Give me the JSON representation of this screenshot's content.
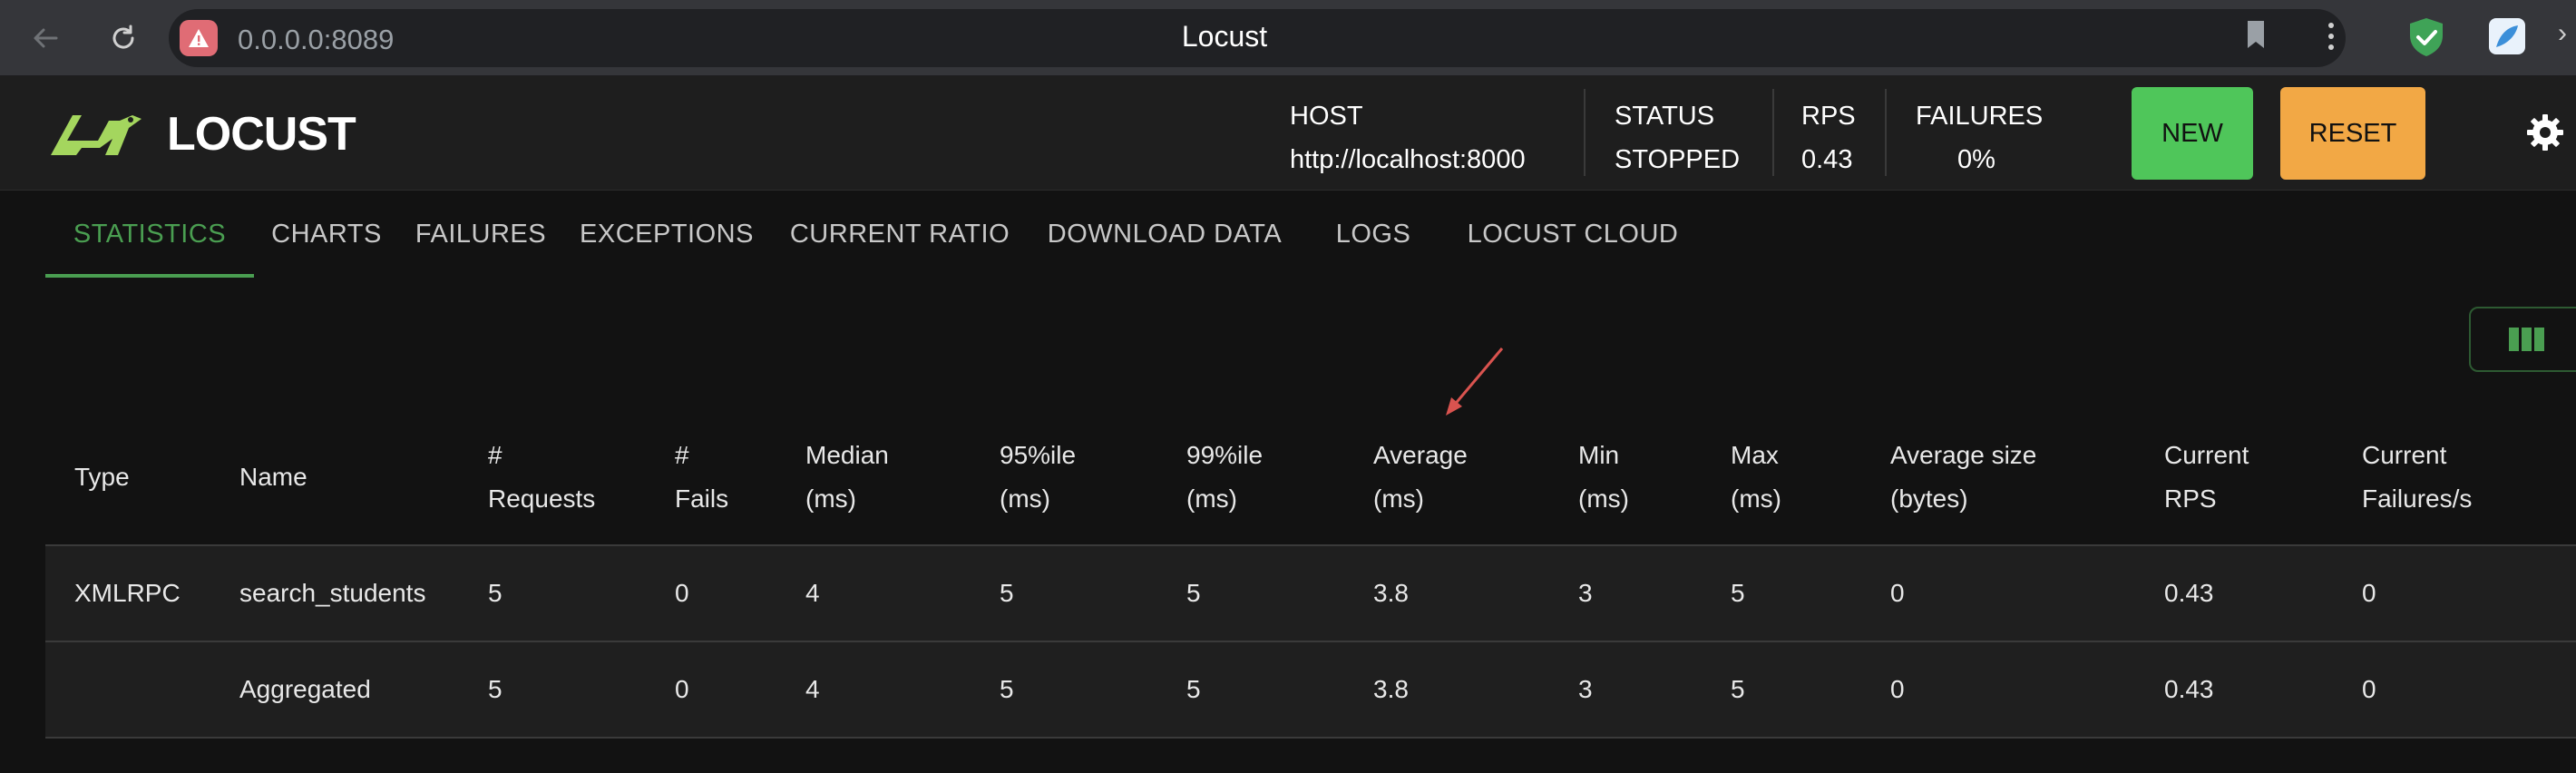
{
  "browser": {
    "url": "0.0.0.0:8089",
    "tab_title": "Locust"
  },
  "app": {
    "logo_text": "LOCUST",
    "stats": [
      {
        "label": "HOST",
        "value": "http://localhost:8000"
      },
      {
        "label": "STATUS",
        "value": "STOPPED"
      },
      {
        "label": "RPS",
        "value": "0.43"
      },
      {
        "label": "FAILURES",
        "value": "0%"
      }
    ],
    "buttons": {
      "new": "NEW",
      "reset": "RESET"
    }
  },
  "tabs": [
    {
      "label": "STATISTICS",
      "active": true
    },
    {
      "label": "CHARTS",
      "active": false
    },
    {
      "label": "FAILURES",
      "active": false
    },
    {
      "label": "EXCEPTIONS",
      "active": false
    },
    {
      "label": "CURRENT RATIO",
      "active": false
    },
    {
      "label": "DOWNLOAD DATA",
      "active": false
    },
    {
      "label": "LOGS",
      "active": false
    },
    {
      "label": "LOCUST CLOUD",
      "active": false
    }
  ],
  "table": {
    "headers": [
      "Type",
      "Name",
      "#\nRequests",
      "#\nFails",
      "Median\n(ms)",
      "95%ile\n(ms)",
      "99%ile\n(ms)",
      "Average\n(ms)",
      "Min\n(ms)",
      "Max\n(ms)",
      "Average size\n(bytes)",
      "Current\nRPS",
      "Current\nFailures/s"
    ],
    "rows": [
      [
        "XMLRPC",
        "search_students",
        "5",
        "0",
        "4",
        "5",
        "5",
        "3.8",
        "3",
        "5",
        "0",
        "0.43",
        "0"
      ],
      [
        "",
        "Aggregated",
        "5",
        "0",
        "4",
        "5",
        "5",
        "3.8",
        "3",
        "5",
        "0",
        "0.43",
        "0"
      ]
    ]
  },
  "icons": {
    "back": "back-arrow-icon",
    "reload": "reload-icon",
    "warning": "warning-icon",
    "bookmark": "bookmark-icon",
    "menu": "menu-dots-icon",
    "shield": "shield-check-icon",
    "settings": "gear-icon",
    "columns": "columns-icon"
  },
  "colors": {
    "accent_green": "#4a9e51",
    "new_button": "#4fc65a",
    "reset_button": "#f2a845",
    "annotation_arrow": "#d9534f"
  }
}
